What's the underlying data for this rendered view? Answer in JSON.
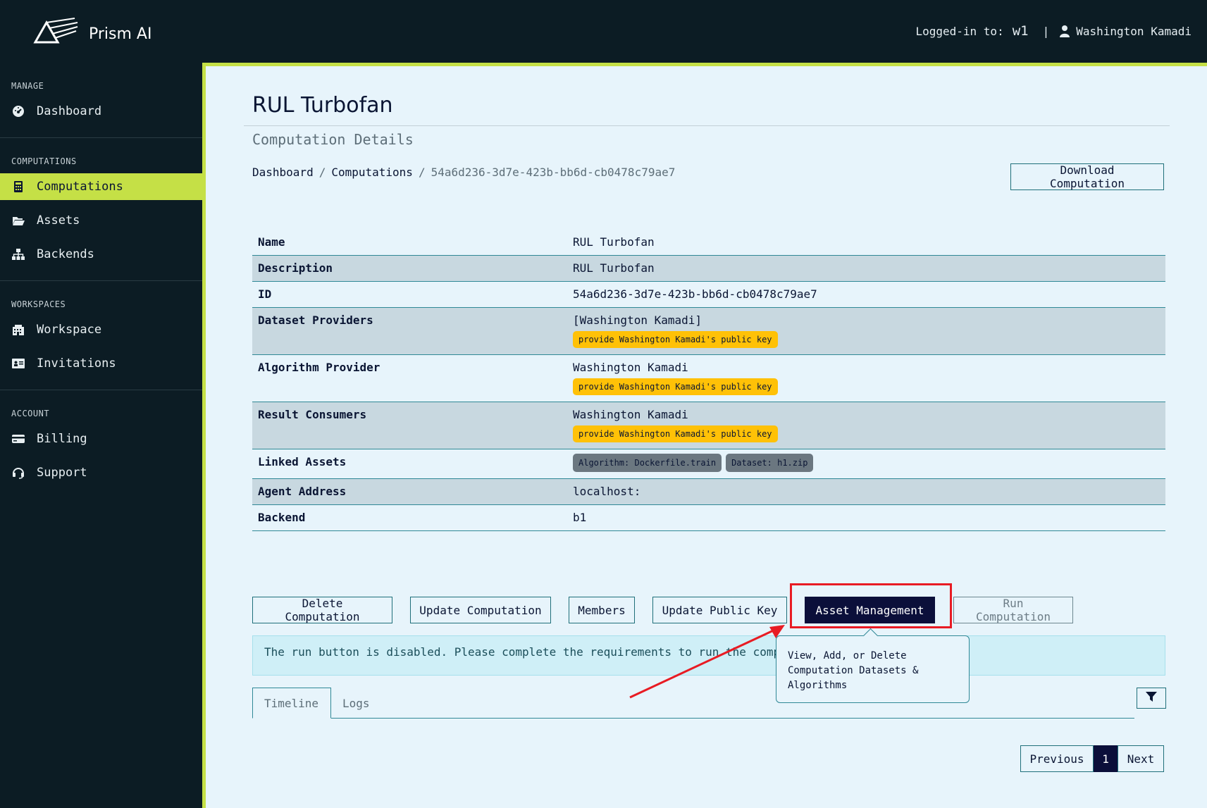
{
  "header": {
    "brand": "Prism AI",
    "logged_in_label": "Logged-in to:",
    "workspace": "w1",
    "separator": "|",
    "user_name": "Washington Kamadi"
  },
  "sidebar": {
    "sections": [
      {
        "title": "MANAGE",
        "items": [
          {
            "label": "Dashboard",
            "icon": "gauge-icon"
          }
        ]
      },
      {
        "title": "COMPUTATIONS",
        "items": [
          {
            "label": "Computations",
            "icon": "calculator-icon",
            "active": true
          },
          {
            "label": "Assets",
            "icon": "folder-open-icon"
          },
          {
            "label": "Backends",
            "icon": "sitemap-icon"
          }
        ]
      },
      {
        "title": "WORKSPACES",
        "items": [
          {
            "label": "Workspace",
            "icon": "building-icon"
          },
          {
            "label": "Invitations",
            "icon": "id-card-icon"
          }
        ]
      },
      {
        "title": "ACCOUNT",
        "items": [
          {
            "label": "Billing",
            "icon": "credit-card-icon"
          },
          {
            "label": "Support",
            "icon": "headset-icon"
          }
        ]
      }
    ]
  },
  "main": {
    "title": "RUL Turbofan",
    "subtitle": "Computation Details",
    "breadcrumb": {
      "home": "Dashboard",
      "section": "Computations",
      "sep": "/",
      "current": "54a6d236-3d7e-423b-bb6d-cb0478c79ae7"
    },
    "download_button": "Download Computation",
    "details": {
      "name": {
        "label": "Name",
        "value": "RUL Turbofan"
      },
      "description": {
        "label": "Description",
        "value": "RUL Turbofan"
      },
      "id": {
        "label": "ID",
        "value": "54a6d236-3d7e-423b-bb6d-cb0478c79ae7"
      },
      "dataset_providers": {
        "label": "Dataset Providers",
        "value": "[Washington Kamadi]",
        "badge": "provide Washington Kamadi's public key"
      },
      "algorithm_provider": {
        "label": "Algorithm Provider",
        "value": "Washington Kamadi",
        "badge": "provide Washington Kamadi's public key"
      },
      "result_consumers": {
        "label": "Result Consumers",
        "value": "Washington Kamadi",
        "badge": "provide Washington Kamadi's public key"
      },
      "linked_assets": {
        "label": "Linked Assets",
        "algorithm": "Algorithm: Dockerfile.train",
        "dataset": "Dataset: h1.zip"
      },
      "agent_address": {
        "label": "Agent Address",
        "value": "localhost:"
      },
      "backend": {
        "label": "Backend",
        "value": "b1"
      }
    },
    "actions": {
      "delete": "Delete Computation",
      "update": "Update Computation",
      "members": "Members",
      "update_key": "Update Public Key",
      "asset_management": "Asset Management",
      "run": "Run Computation"
    },
    "alert": "The run button is disabled. Please complete the requirements to run the comp",
    "tooltip": "View, Add, or Delete Computation Datasets & Algorithms",
    "tabs": {
      "timeline": "Timeline",
      "logs": "Logs"
    },
    "pager": {
      "previous": "Previous",
      "page": "1",
      "next": "Next"
    },
    "colors": {
      "accent": "#c5e046",
      "dark": "#0c1c24",
      "primary": "#0b0f3a",
      "warning": "#ffc107",
      "annotation": "#e81b23"
    }
  }
}
